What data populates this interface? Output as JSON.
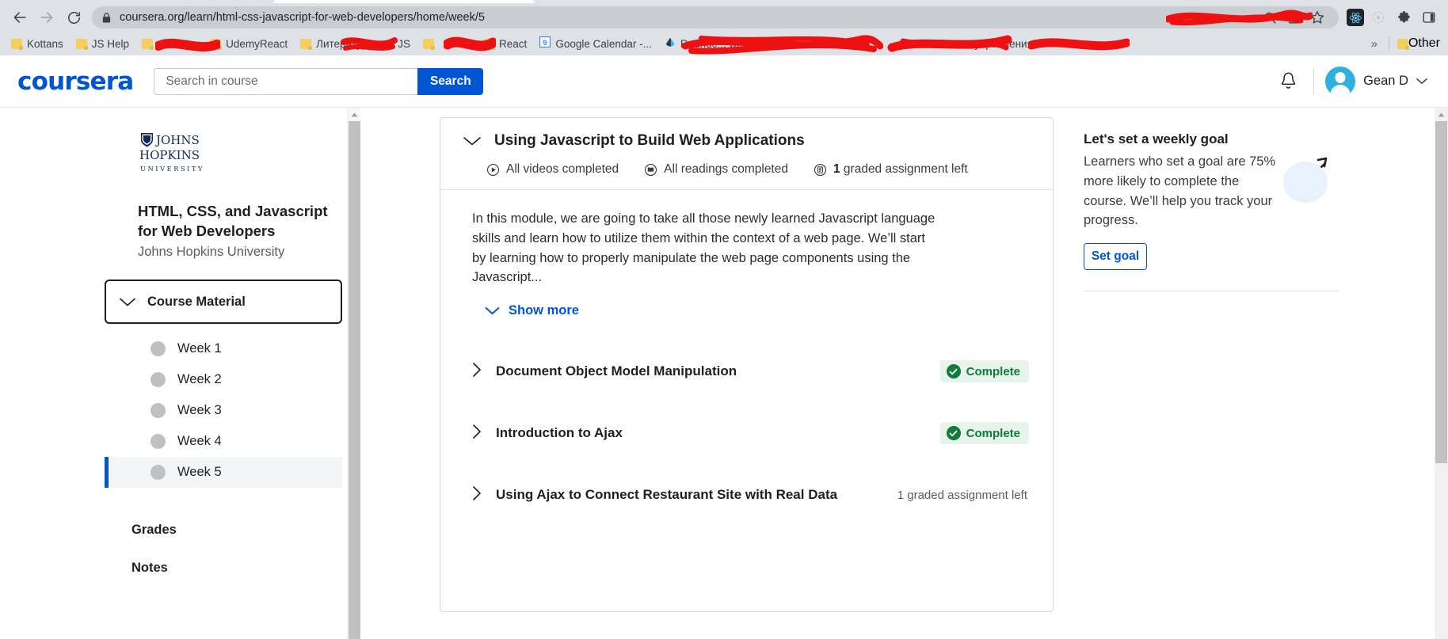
{
  "browser": {
    "url": "coursera.org/learn/html-css-javascript-for-web-developers/home/week/5",
    "back_label": "Back",
    "forward_label": "Forward",
    "reload_label": "Reload",
    "lock_icon": "lock-icon",
    "zoom_out_icon": "zoom-out-icon",
    "share_icon": "share-icon",
    "bookmark_star_icon": "star-icon",
    "extensions_icon": "puzzle-icon",
    "side_panel_icon": "side-panel-icon",
    "react_devtools_icon": "react-extension-icon",
    "profile_icon": "profile-icon",
    "bookmarks": [
      {
        "label": "Kottans",
        "icon": "folder-icon",
        "redacted": false
      },
      {
        "label": "JS Help",
        "icon": "folder-icon",
        "redacted": false
      },
      {
        "label": "",
        "icon": "folder-icon",
        "redacted": true
      },
      {
        "label": "UdemyReact",
        "icon": "folder-icon",
        "redacted": false
      },
      {
        "label": "Литература для JS",
        "icon": "folder-icon",
        "redacted": true
      },
      {
        "label": "",
        "icon": "folder-icon",
        "redacted": true
      },
      {
        "label": "React",
        "icon": "folder-icon",
        "redacted": false
      },
      {
        "label": "Google Calendar -...",
        "icon": "calendar-icon",
        "redacted": false
      },
      {
        "label": "Roundc... webm...",
        "icon": "site-icon",
        "redacted": true
      },
      {
        "label": "",
        "icon": "site-icon",
        "redacted": true
      },
      {
        "label": "Панель управления",
        "icon": "site-icon",
        "redacted": true
      },
      {
        "label": "",
        "icon": "site-icon",
        "redacted": true
      }
    ],
    "overflow_label": "»",
    "other_bookmarks_label": "Other"
  },
  "header": {
    "logo": "coursera",
    "search": {
      "placeholder": "Search in course",
      "value": "",
      "button_label": "Search"
    },
    "notifications_icon": "bell-icon",
    "account_name": "Gean D",
    "account_chevron_icon": "chevron-down-icon",
    "avatar_icon": "avatar-icon"
  },
  "sidebar": {
    "university_logo": "johns-hopkins-logo",
    "university_lines": [
      "JOHNS",
      "HOPKINS",
      "UNIVERSITY"
    ],
    "course_title": "HTML, CSS, and Javascript for Web Developers",
    "course_partner": "Johns Hopkins University",
    "course_material": {
      "label": "Course Material",
      "chevron_icon": "chevron-down-icon",
      "expanded": true
    },
    "weeks": [
      {
        "label": "Week 1",
        "active": false
      },
      {
        "label": "Week 2",
        "active": false
      },
      {
        "label": "Week 3",
        "active": false
      },
      {
        "label": "Week 4",
        "active": false
      },
      {
        "label": "Week 5",
        "active": true
      }
    ],
    "links": [
      {
        "label": "Grades"
      },
      {
        "label": "Notes"
      }
    ]
  },
  "module": {
    "title": "Using Javascript to Build Web Applications",
    "collapse_icon": "chevron-down-icon",
    "stats": [
      {
        "icon": "play-circle-icon",
        "text": "All videos completed",
        "bold_prefix": ""
      },
      {
        "icon": "book-icon",
        "text": "All readings completed",
        "bold_prefix": ""
      },
      {
        "icon": "assignment-icon",
        "text": " graded assignment left",
        "bold_prefix": "1"
      }
    ],
    "description": "In this module, we are going to take all those newly learned Javascript language skills and learn how to utilize them within the context of a web page. We’ll start by learning how to properly manipulate the web page components using the Javascript...",
    "show_more": {
      "label": "Show more",
      "chevron_icon": "chevron-down-icon"
    },
    "lessons": [
      {
        "title": "Document Object Model Manipulation",
        "chevron_icon": "chevron-right-icon",
        "status_type": "badge",
        "status_label": "Complete",
        "status_icon": "check-circle-icon"
      },
      {
        "title": "Introduction to Ajax",
        "chevron_icon": "chevron-right-icon",
        "status_type": "badge",
        "status_label": "Complete",
        "status_icon": "check-circle-icon"
      },
      {
        "title": "Using Ajax to Connect Restaurant Site with Real Data",
        "chevron_icon": "chevron-right-icon",
        "status_type": "note",
        "status_label": "1 graded assignment left",
        "status_icon": ""
      }
    ]
  },
  "right_rail": {
    "goal_title": "Let's set a weekly goal",
    "goal_text": "Learners who set a goal are 75% more likely to complete the course. We’ll help you track your progress.",
    "set_goal_label": "Set goal",
    "target_icon": "target-dart-icon"
  },
  "colors": {
    "accent": "#0056D2",
    "complete_green": "#0f7a3d",
    "complete_bg": "#e7f4ec",
    "avatar_blue": "#2fb0e0",
    "redaction_red": "#ee1111",
    "chrome_bg": "#dee1e6"
  },
  "scrollbars": {
    "sidebar_arrow_icon": "scroll-up-arrow-icon",
    "page_arrow_icon": "scroll-up-arrow-icon"
  }
}
